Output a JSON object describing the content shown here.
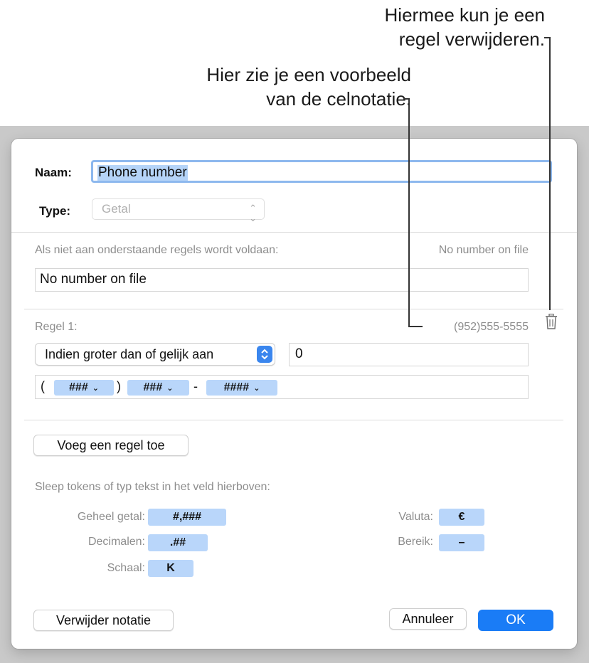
{
  "callouts": {
    "delete_rule": {
      "line1": "Hiermee kun je een",
      "line2": "regel verwijderen."
    },
    "preview": {
      "line1": "Hier zie je een voorbeeld",
      "line2": "van de celnotatie."
    }
  },
  "dialog": {
    "name_label": "Naam:",
    "name_value": "Phone number",
    "type_label": "Type:",
    "type_value": "Getal",
    "fallback": {
      "label": "Als niet aan onderstaande regels wordt voldaan:",
      "preview": "No number on file",
      "value": "No number on file"
    },
    "rule": {
      "label": "Regel 1:",
      "preview": "(952)555-5555",
      "condition": "Indien groter dan of gelijk aan",
      "condition_value": "0",
      "format": {
        "open_paren": "(",
        "token1": "###",
        "close_paren": ")",
        "token2": "###",
        "dash": "-",
        "token3": "####"
      }
    },
    "add_rule_button": "Voeg een regel toe",
    "tokens_hint": "Sleep tokens of typ tekst in het veld hierboven:",
    "tokens": {
      "integer": {
        "label": "Geheel getal:",
        "token": "#,###"
      },
      "decimals": {
        "label": "Decimalen:",
        "token": ".##"
      },
      "scale": {
        "label": "Schaal:",
        "token": "K"
      },
      "currency": {
        "label": "Valuta:",
        "token": "€"
      },
      "range": {
        "label": "Bereik:",
        "token": "–"
      }
    },
    "remove_format_button": "Verwijder notatie",
    "cancel_button": "Annuleer",
    "ok_button": "OK"
  },
  "colors": {
    "accent": "#1a7cf6",
    "token_bg": "#b9d6fa",
    "selection": "#b5d4f8"
  },
  "icons": {
    "chevron": "chevron-down-icon",
    "stepper": "up-down-arrows-icon",
    "trash": "trash-icon"
  }
}
